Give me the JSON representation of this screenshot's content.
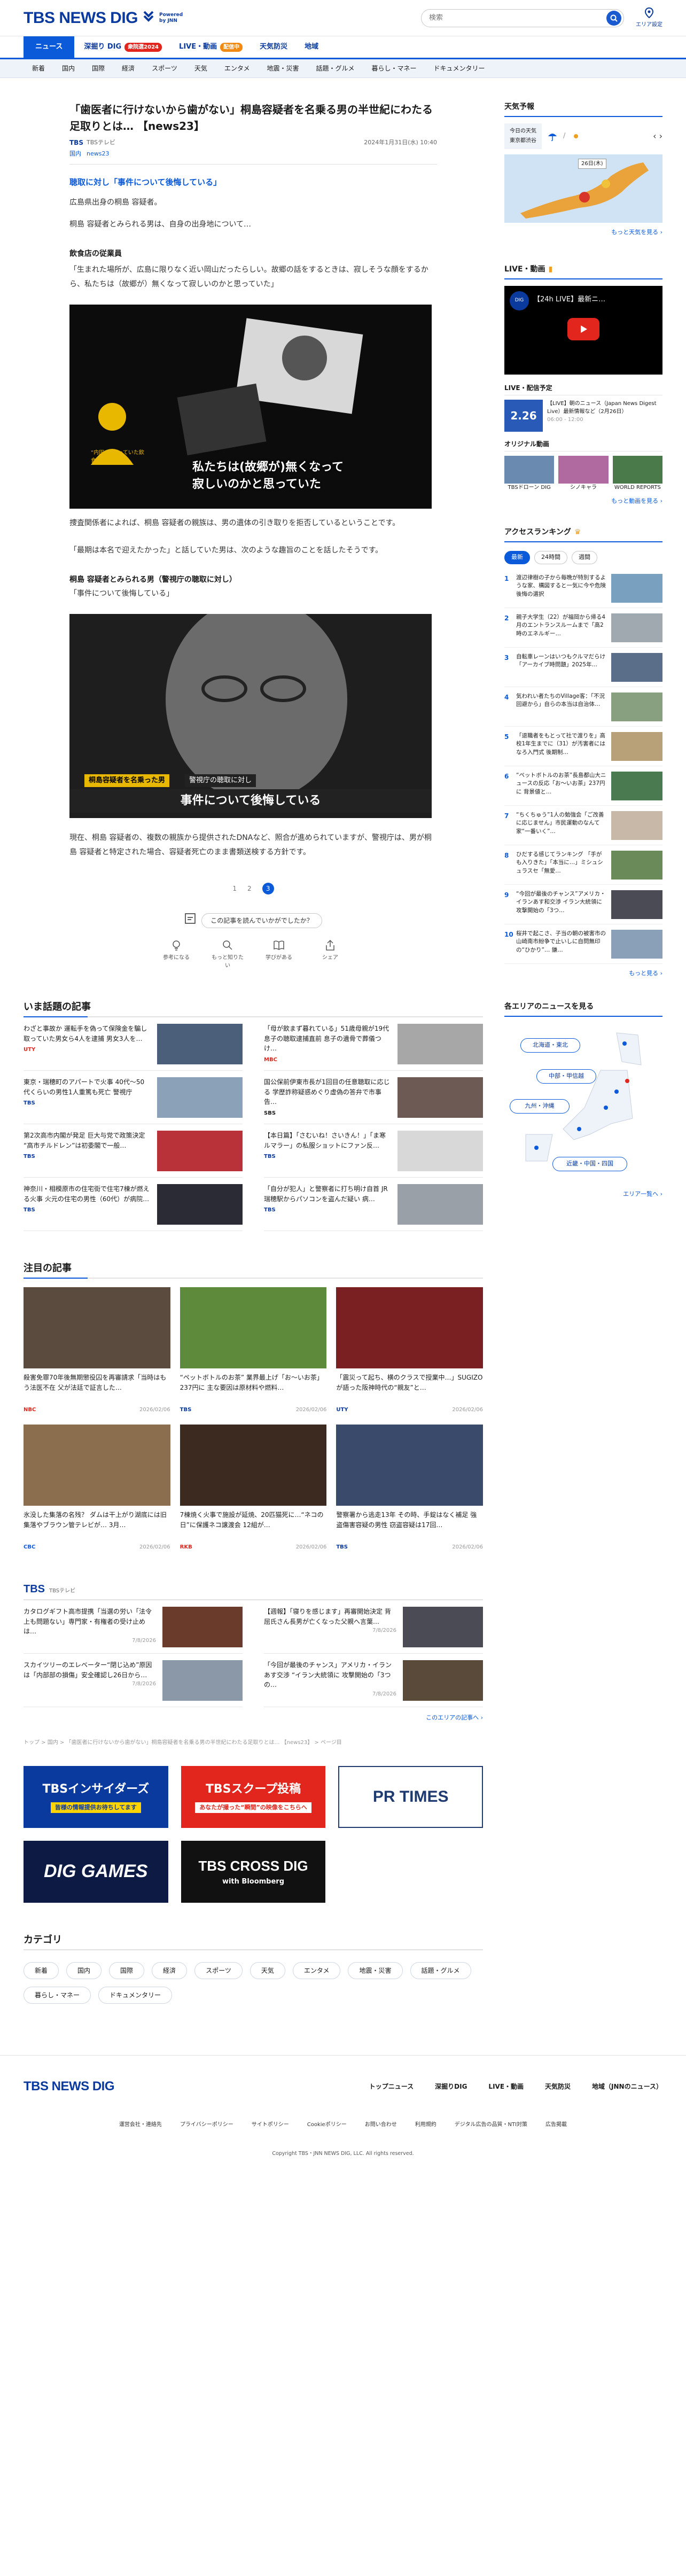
{
  "header": {
    "logo": "TBS NEWS DIG",
    "powered1": "Powered",
    "powered2": "by JNN",
    "search_placeholder": "検索",
    "area_label": "エリア設定"
  },
  "nav1": [
    {
      "label": "ニュース"
    },
    {
      "label": "深掘り DIG",
      "badge": "衆院選2024"
    },
    {
      "label": "LIVE・動画",
      "badge": "配信中"
    },
    {
      "label": "天気防災"
    },
    {
      "label": "地域"
    }
  ],
  "nav2": [
    "新着",
    "国内",
    "国際",
    "経済",
    "スポーツ",
    "天気",
    "エンタメ",
    "地震・災害",
    "話題・グルメ",
    "暮らし・マネー",
    "ドキュメンタリー"
  ],
  "article": {
    "title": "「歯医者に行けないから歯がない」桐島容疑者を名乗る男の半世紀にわたる足取りとは… 【news23】",
    "source": "TBS",
    "source_name": "TBSテレビ",
    "date": "2024年1月31日(水) 10:40",
    "tag1": "国内",
    "tag2": "news23",
    "h_q1": "聴取に対し「事件について後悔している」",
    "p1": "広島県出身の桐島 容疑者。",
    "p2": "桐島 容疑者とみられる男は、自身の出身地について…",
    "h_shop": "飲食店の従業員",
    "p3": "「生まれた場所が、広島に限りなく近い岡山だったらしい。故郷の話をするときは、寂しそうな顔をするから、私たちは（故郷が）無くなって寂しいのかと思っていた」",
    "fig1_cap1": "私たちは(故郷が)無くなって",
    "fig1_cap2": "寂しいのかと思っていた",
    "fig1_who": "“内田”が通っていた飲食店の従業員",
    "p4": "捜査関係者によれば、桐島 容疑者の親族は、男の遺体の引き取りを拒否しているということです。",
    "p5": "「最期は本名で迎えたかった」と話していた男は、次のような趣旨のことを話したそうです。",
    "h_police": "桐島 容疑者とみられる男（警視庁の聴取に対し）",
    "p6": "「事件について後悔している」",
    "fig2_tag1": "桐島容疑者を名乗った男",
    "fig2_tag2": "警視庁の聴取に対し",
    "fig2_cap": "事件について後悔している",
    "p7": "現在、桐島 容疑者の、複数の親族から提供されたDNAなど、照合が進められていますが、警視庁は、男が桐島 容疑者と特定された場合、容疑者死亡のまま書類送検する方針です。",
    "pages": [
      "1",
      "2",
      "3"
    ],
    "feedback_q": "この記事を読んでいかがでしたか？",
    "feedback_icons": [
      "参考になる",
      "もっと知りたい",
      "学びがある",
      "シェア"
    ]
  },
  "hot": {
    "title": "いま話題の記事",
    "items": [
      {
        "text": "わざと事故か 運転手を偽って保険金を騙し取っていた男女ら4人を逮捕 男女3人を…",
        "src": "UTY"
      },
      {
        "text": "「母が飲まず暮れている」51歳母親が19代息子の聴取逮捕直前 息子の遺骨で葬儀つけ…",
        "src": "MBC"
      },
      {
        "text": "東京・瑞穂町のアパートで火事 40代〜50代くらいの男性1人重篤も死亡 警視庁",
        "src": "TBS"
      },
      {
        "text": "国公保前伊東市長が1回目の任意聴取に応じる 学歴詐称疑惑めぐり虚偽の答弁で市事告…",
        "src": "SBS"
      },
      {
        "text": "第2次高市内閣が発足 巨大与党で政策決定 “高市チルドレン”は初委閣で一般…",
        "src": "TBS"
      },
      {
        "text": "【本日篇】「さむいね！さいきん！」「ま寒ルマラー」の私服ショットにファン反…",
        "src": "TBS"
      },
      {
        "text": "神奈川・相模原市の住宅街で住宅7棟が燃える火事 火元の住宅の男性（60代）が病院…",
        "src": "TBS"
      },
      {
        "text": "「自分が犯人」と警察者に打ち明け自首 JR瑞穂駅からパソコンを盗んだ疑い 病…",
        "src": "TBS"
      }
    ]
  },
  "featured": {
    "title": "注目の記事",
    "items": [
      {
        "text": "殺害免罪70年後無期懲役囚を再審請求「当時はもう法医不在 父が法廷で証言した…",
        "src": "NBC",
        "date": "2026/02/06"
      },
      {
        "text": "“ペットボトルのお茶” 業界最上げ「お〜いお茶」237円に 主な要因は原材料や燃料…",
        "src": "TBS",
        "date": "2026/02/06"
      },
      {
        "text": "「震災って起ち、横のクラスで授業中…」SUGIZOが語った阪神時代の“親友”と…",
        "src": "UTY",
        "date": "2026/02/06"
      },
      {
        "text": "氷没した集落の名残？ ダムは干上がり湖底には旧集落やブラウン管テレビが… 3月…",
        "src": "CBC",
        "date": "2026/02/06"
      },
      {
        "text": "7棟焼く火事で施設が延焼、20匹猫死に…“ネコの日”に保護ネコ譲渡会 12組が…",
        "src": "RKB",
        "date": "2026/02/06"
      },
      {
        "text": "警察署から逃走13年 その時、手錠はなく補足 強盗傷害容疑の男性 窃盗容疑は17回…",
        "src": "TBS",
        "date": "2026/02/06"
      }
    ]
  },
  "tbs": {
    "logo": "TBS",
    "sub": "TBSテレビ",
    "items": [
      {
        "text": "カタログギフト高市提携「当選の労い「法令上も問題ない」専門家・有権者の受け止めは…",
        "date": "7/8/2026"
      },
      {
        "text": "【週報】「寝りを感じます」再審開始決定 背屈氏さん長男が亡くなった父親へ言葉…",
        "date": "7/8/2026"
      },
      {
        "text": "スカイツリーのエレベーター“閉じ込め”原因は「内部部の損傷」安全確認し26日から…",
        "date": "7/8/2026"
      },
      {
        "text": "「今回が最後のチャンス」アメリカ・イランあす交渉 “イラン大統領に 攻撃開始の「3つの…",
        "date": "7/8/2026"
      }
    ],
    "more": "このエリアの記事へ ›"
  },
  "breadcrumb": "トップ > 国内 > 「歯医者に行けないから歯がない」桐島容疑者を名乗る男の半世紀にわたる足取りとは… 【news23】 > ページ目",
  "banners": [
    {
      "text": "TBSインサイダーズ",
      "sub": "皆様の情報提供お待ちしてます"
    },
    {
      "text": "TBSスクープ投稿",
      "sub": "あなたが撮った“瞬間”の映像をこちらへ"
    },
    {
      "text": "PR TIMES"
    },
    {
      "text": "DIG GAMES"
    },
    {
      "text": "TBS CROSS DIG",
      "sub": "with Bloomberg"
    }
  ],
  "categories": {
    "title": "カテゴリ",
    "items": [
      "新着",
      "国内",
      "国際",
      "経済",
      "スポーツ",
      "天気",
      "エンタメ",
      "地震・災害",
      "話題・グルメ",
      "暮らし・マネー",
      "ドキュメンタリー"
    ]
  },
  "side": {
    "weather_title": "天気予報",
    "weather_today": "今日の天気",
    "weather_area": "東京都渋谷",
    "weather_temp": "26日(木)",
    "weather_more": "もっと天気を見る ›",
    "live_title": "LIVE・動画",
    "live_video": "【24h LIVE】最新ニ…",
    "live_sched": "LIVE・配信予定",
    "live_date": "2.26",
    "live_item": "【LIVE】朝のニュース（Japan News Digest Live）最新情報など（2月26日）",
    "live_time": "06:00 - 12:00",
    "orig_title": "オリジナル動画",
    "orig": [
      "TBSドローン DIG",
      "シノキャラ",
      "WORLD REPORTS"
    ],
    "video_more": "もっと動画を見る ›",
    "rank_title": "アクセスランキング",
    "rank_tabs": [
      "最新",
      "24時間",
      "週間"
    ],
    "rank": [
      "渡辺律樹の子から毎晩が特別するような家、構図すると一気に今や危険 後悔の選択",
      "親子大学生（22）が福岡から帰る4月のエントランスルームまで「高2時のエネルギー…",
      "自転車レーンはいつもクルマだらけ「アーカイブ時問題」2025年…",
      "気われい者たちのVillage客：「不況回避から」自らの本当は自治体…",
      "「退職者をもとって社で渡りを」高校1年生までに（31）が汚害者にはなろ入門式 後期制…",
      "“ペットボトルのお茶”長島都山大ニュースの反応「お〜いお茶」237円に 背景値と…",
      "“ちくちゅう”1人の勉強会「ご改善に応じません」市民運動のなんて家“一番いく”…",
      "ひだする感じてランキング 「手がも入りきた」「本当に…」ミシュシュラスセ「無愛…",
      "“今回が最後のチャンス”アメリカ・イランあす和交渉 イラン大統領に 攻撃開始の「3つ…",
      "桜井で起こさ、子当の朝の被害市の山崎南市紛争で止いしに自問無印の“ひかり”… 鎌…"
    ],
    "rank_more": "もっと見る ›",
    "area_title": "各エリアのニュースを見る",
    "areas": [
      "北海道・東北",
      "中部・甲信越",
      "九州・沖縄",
      "近畿・中国・四国"
    ],
    "area_more": "エリア一覧へ ›"
  },
  "footer": {
    "logo": "TBS NEWS DIG",
    "links": [
      "トップニュース",
      "深掘りDIG",
      "LIVE・動画",
      "天気防災",
      "地域（JNNのニュース）"
    ],
    "sub": [
      "運営会社・連絡先",
      "プライバシーポリシー",
      "サイトポリシー",
      "Cookieポリシー",
      "お問い合わせ",
      "利用規約",
      "デジタル広告の品質・NTI対策",
      "広告掲載"
    ],
    "copy": "Copyright TBS・JNN NEWS DIG, LLC. All rights reserved."
  },
  "colors": {
    "brand": "#0b3a9e",
    "accent": "#0b5ad9",
    "red": "#e2261d"
  }
}
